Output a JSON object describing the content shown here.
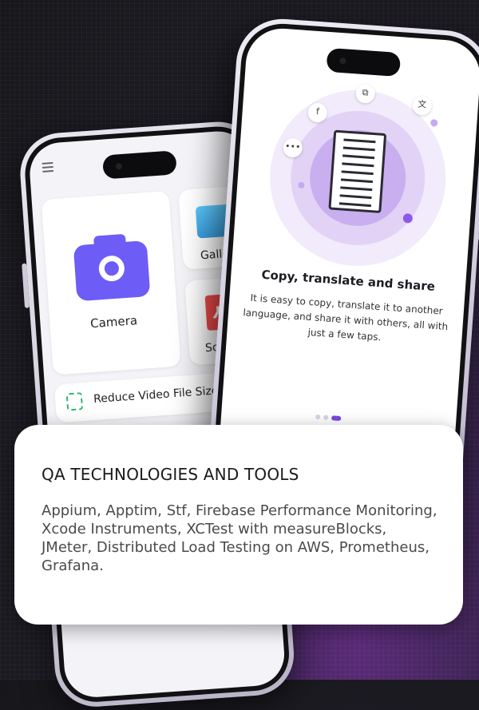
{
  "back_phone": {
    "camera_label": "Camera",
    "gallery_label": "Gallery",
    "scan_label": "Scan PDF",
    "reduce_label": "Reduce Video File Size"
  },
  "front_phone": {
    "title": "Copy, translate and share",
    "body": "It is easy to copy, translate it to another language, and share it with others, all with just a few taps."
  },
  "info_card": {
    "title": "QA TECHNOLOGIES AND TOOLS",
    "body": "Appium, Apptim, Stf, Firebase Performance Monitoring, Xcode Instruments, XCTest with measureBlocks, JMeter, Distributed Load Testing on AWS, Prometheus, Grafana."
  },
  "colors": {
    "accent_purple": "#6e5cf6",
    "pdf_red": "#ee4b4b",
    "pager_active": "#7a48e0"
  }
}
